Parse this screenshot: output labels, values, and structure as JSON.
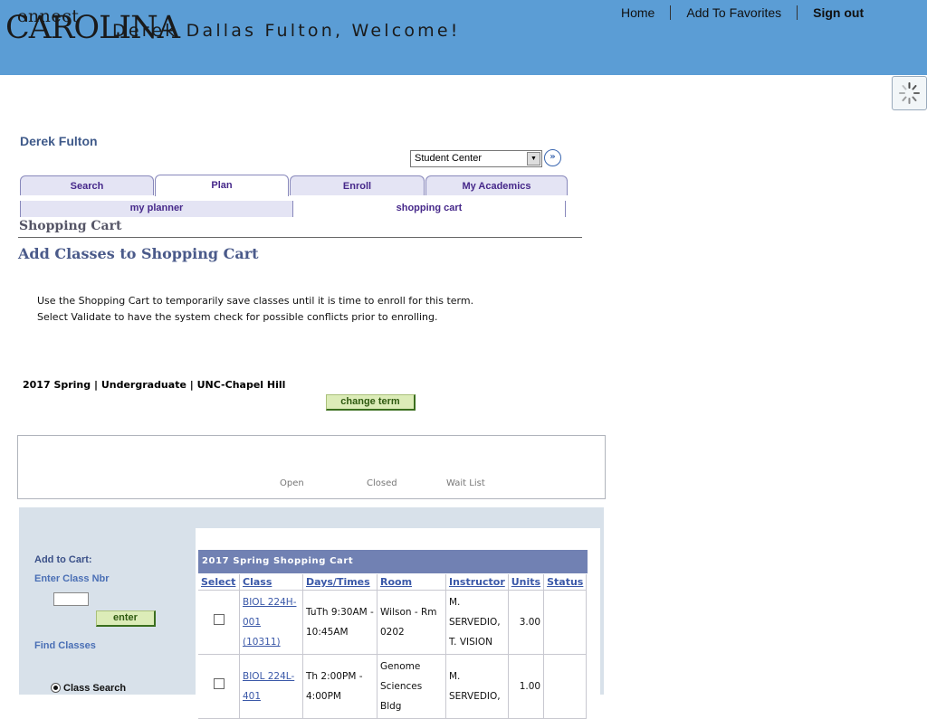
{
  "header": {
    "logo_line1": "onnect",
    "logo_line2": "CAROLINA",
    "welcome": "Derek Dallas Fulton, Welcome!",
    "nav": {
      "home": "Home",
      "favorites": "Add To Favorites",
      "signout": "Sign out"
    }
  },
  "user": {
    "name": "Derek Fulton"
  },
  "navigate": {
    "selected": "Student Center"
  },
  "tabs": [
    {
      "label": "Search"
    },
    {
      "label": "Plan"
    },
    {
      "label": "Enroll"
    },
    {
      "label": "My Academics"
    }
  ],
  "subtabs": [
    {
      "label": "my planner"
    },
    {
      "label": "shopping cart"
    }
  ],
  "page": {
    "section_title": "Shopping Cart",
    "heading": "Add Classes to Shopping Cart",
    "instruction_1": "Use the Shopping Cart to temporarily save classes until it is time to enroll for this term.",
    "instruction_2": "Select Validate to have the system check for possible conflicts prior to enrolling.",
    "term": "2017 Spring | Undergraduate | UNC-Chapel Hill",
    "change_term": "change term"
  },
  "legend": {
    "open": "Open",
    "closed": "Closed",
    "waitlist": "Wait List"
  },
  "add_to_cart": {
    "title": "Add to Cart:",
    "enter_class_nbr": "Enter Class Nbr",
    "class_nbr_value": "",
    "enter_button": "enter",
    "find_classes": "Find Classes",
    "class_search": "Class Search"
  },
  "cart": {
    "title": "2017 Spring Shopping Cart",
    "columns": [
      "Select",
      "Class",
      "Days/Times",
      "Room",
      "Instructor",
      "Units",
      "Status"
    ],
    "rows": [
      {
        "class_l1": "BIOL 224H-",
        "class_l2": "001",
        "class_l3": "(10311)",
        "days_l1": "TuTh 9:30AM -",
        "days_l2": "10:45AM",
        "room_l1": "Wilson - Rm",
        "room_l2": "0202",
        "instr_l1": "M.",
        "instr_l2": "SERVEDIO,",
        "instr_l3": "T. VISION",
        "units": "3.00"
      },
      {
        "class_l1": "BIOL 224L-",
        "class_l2": "401",
        "days_l1": "Th 2:00PM -",
        "days_l2": "4:00PM",
        "room_l1": "Genome",
        "room_l2": "Sciences Bldg",
        "instr_l1": "M.",
        "instr_l2": "SERVEDIO,",
        "units": "1.00"
      }
    ]
  },
  "colors": {
    "header_bg": "#5b9dd5",
    "grid_header": "#7181b3",
    "panel_bg": "#d8e1ea",
    "button_green": "#dcecb8"
  }
}
